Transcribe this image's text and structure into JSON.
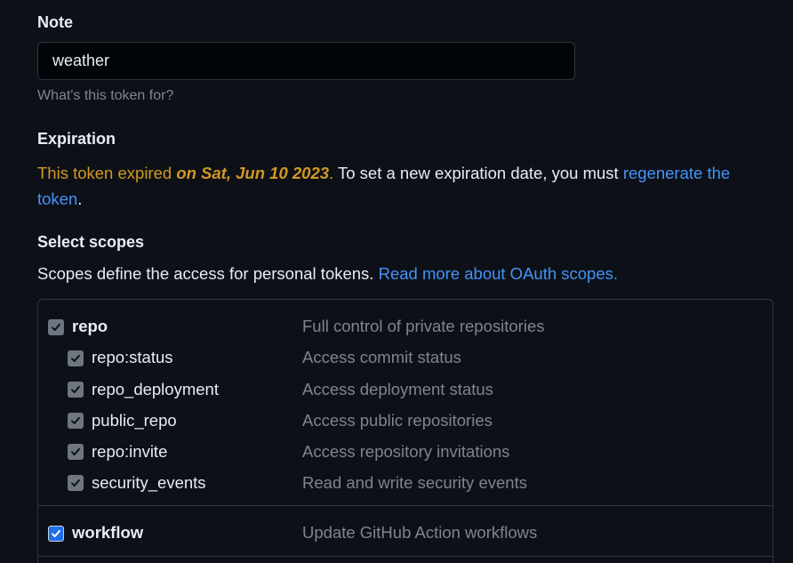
{
  "note": {
    "label": "Note",
    "value": "weather",
    "hint": "What's this token for?"
  },
  "expiration": {
    "label": "Expiration",
    "warning_prefix": "This token expired ",
    "expired_date": "on Sat, Jun 10 2023",
    "warning_period": ".",
    "instruction": " To set a new expiration date, you must ",
    "regenerate_link": "regenerate the token",
    "trailing_period": "."
  },
  "scopes": {
    "label": "Select scopes",
    "description": "Scopes define the access for personal tokens. ",
    "read_more_link": "Read more about OAuth scopes.",
    "groups": [
      {
        "name": "repo",
        "description": "Full control of private repositories",
        "checked": true,
        "disabled": true,
        "children": [
          {
            "name": "repo:status",
            "description": "Access commit status",
            "checked": true,
            "disabled": true
          },
          {
            "name": "repo_deployment",
            "description": "Access deployment status",
            "checked": true,
            "disabled": true
          },
          {
            "name": "public_repo",
            "description": "Access public repositories",
            "checked": true,
            "disabled": true
          },
          {
            "name": "repo:invite",
            "description": "Access repository invitations",
            "checked": true,
            "disabled": true
          },
          {
            "name": "security_events",
            "description": "Read and write security events",
            "checked": true,
            "disabled": true
          }
        ]
      },
      {
        "name": "workflow",
        "description": "Update GitHub Action workflows",
        "checked": true,
        "disabled": false,
        "children": []
      }
    ]
  },
  "colors": {
    "background": "#0d1117",
    "text": "#e6edf3",
    "muted": "#7d8590",
    "warning": "#d29922",
    "link": "#4493f8",
    "checkbox_active": "#1f6feb",
    "checkbox_disabled": "#6e7681"
  }
}
